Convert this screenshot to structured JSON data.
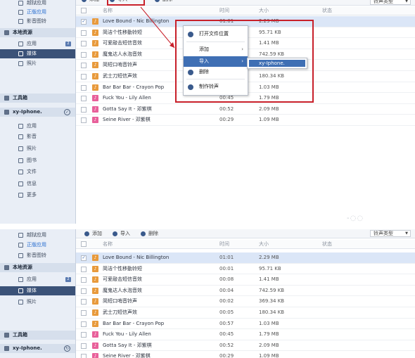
{
  "sidebar": {
    "top": [
      {
        "label": "越狱应用",
        "icon": "puzzle-icon"
      },
      {
        "label": "正版应用",
        "icon": "app-store-icon",
        "state": "link"
      },
      {
        "label": "影音图铃",
        "icon": "music-note-icon"
      }
    ],
    "local": {
      "title": "本地资源",
      "items": [
        {
          "label": "应用",
          "badge": "2",
          "icon": "apps-icon"
        },
        {
          "label": "媒体",
          "selected": true,
          "icon": "media-icon"
        },
        {
          "label": "照片",
          "icon": "photo-icon"
        }
      ]
    },
    "toolbox": {
      "title": "工具箱"
    },
    "device": {
      "name": "xy-Iphone.",
      "items": [
        {
          "label": "应用",
          "icon": "apps-icon"
        },
        {
          "label": "影音",
          "icon": "film-icon"
        },
        {
          "label": "照片",
          "icon": "photo-icon"
        },
        {
          "label": "图书",
          "icon": "book-icon"
        },
        {
          "label": "文件",
          "icon": "file-icon"
        },
        {
          "label": "信息",
          "icon": "message-icon"
        },
        {
          "label": "更多",
          "icon": "more-icon"
        }
      ]
    }
  },
  "toolbar": {
    "add": "添加",
    "import": "导入",
    "delete": "删除",
    "sort": "铃声类型",
    "sort_arrow": "▼"
  },
  "table": {
    "headers": {
      "name": "名称",
      "time": "时间",
      "size": "大小",
      "status": "状态"
    },
    "rows": [
      {
        "name": "Love Bound - Nic Billington",
        "time": "01:01",
        "size": "2.29 MB",
        "icon": "orange",
        "checked": true
      },
      {
        "name": "简洁个性移動铃短",
        "time": "00:01",
        "size": "95.71 KB",
        "icon": "orange"
      },
      {
        "name": "可爱敲击短信音效",
        "time": "00:08",
        "size": "1.41 MB",
        "icon": "orange"
      },
      {
        "name": "魔鬼达人水泡音效",
        "time": "00:04",
        "size": "742.59 KB",
        "icon": "orange"
      },
      {
        "name": "简短口哨音铃声",
        "time": "00:02",
        "size": "369.34 KB",
        "icon": "orange"
      },
      {
        "name": "武士刀短信声效",
        "time": "00:05",
        "size": "180.34 KB",
        "icon": "orange"
      },
      {
        "name": "Bar Bar Bar - Crayon Pop",
        "time": "00:57",
        "size": "1.03 MB",
        "icon": "orange"
      },
      {
        "name": "Fuck You - Lily Allen",
        "time": "00:45",
        "size": "1.79 MB",
        "icon": "pink"
      },
      {
        "name": "Gotta Say It - 邓紫棋",
        "time": "00:52",
        "size": "2.09 MB",
        "icon": "pink"
      },
      {
        "name": "Seine River - 邓紫棋",
        "time": "00:29",
        "size": "1.09 MB",
        "icon": "pink"
      }
    ]
  },
  "context_menu": {
    "open_location": "打开文件位置",
    "add": "添加",
    "import": "导入",
    "delete": "删除",
    "make_ringtone": "制作铃声",
    "chevron": "›",
    "submenu_item": "xy-Iphone."
  },
  "watermark": "-◌◌",
  "colors": {
    "highlight_red": "#c8202a",
    "selection_blue": "#3f6fb4",
    "sidebar_selected": "#3b5278"
  }
}
